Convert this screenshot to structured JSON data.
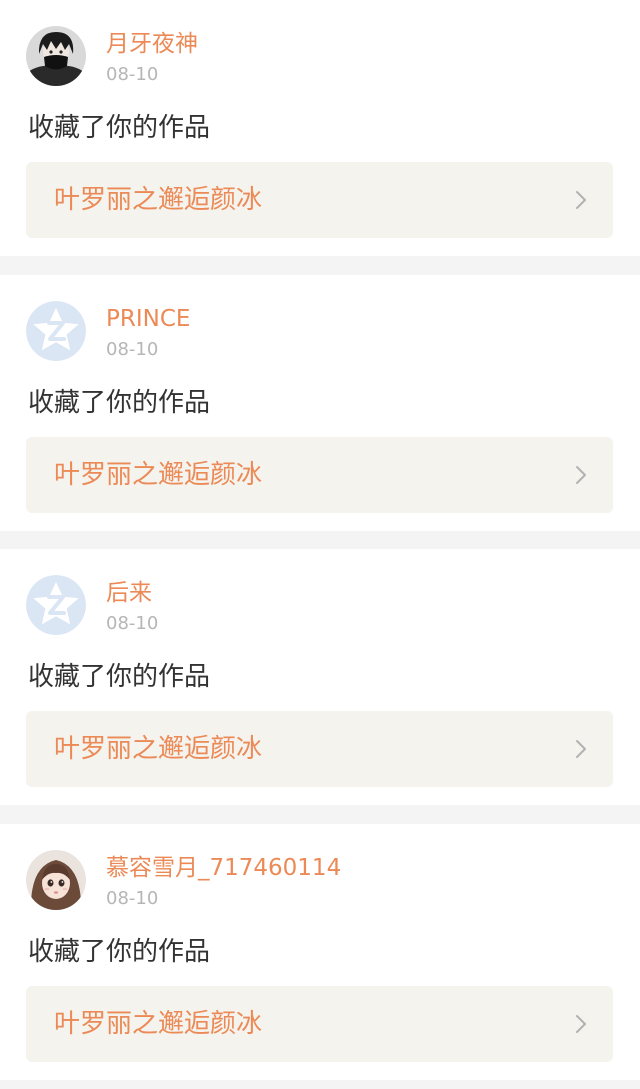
{
  "notifications": [
    {
      "username": "月牙夜神",
      "date": "08-10",
      "action": "收藏了你的作品",
      "work_title": "叶罗丽之邂逅颜冰",
      "avatar": "dark-masked-user-avatar"
    },
    {
      "username": "PRINCE",
      "date": "08-10",
      "action": "收藏了你的作品",
      "work_title": "叶罗丽之邂逅颜冰",
      "avatar": "default-star-avatar"
    },
    {
      "username": "后来",
      "date": "08-10",
      "action": "收藏了你的作品",
      "work_title": "叶罗丽之邂逅颜冰",
      "avatar": "default-star-avatar"
    },
    {
      "username": "慕容雪月_717460114",
      "date": "08-10",
      "action": "收藏了你的作品",
      "work_title": "叶罗丽之邂逅颜冰",
      "avatar": "doll-girl-avatar"
    }
  ],
  "colors": {
    "accent": "#eb8a56",
    "date": "#b6b6b6",
    "text": "#333333",
    "work_background": "#f5f3ee",
    "page_background": "#f4f4f4"
  }
}
